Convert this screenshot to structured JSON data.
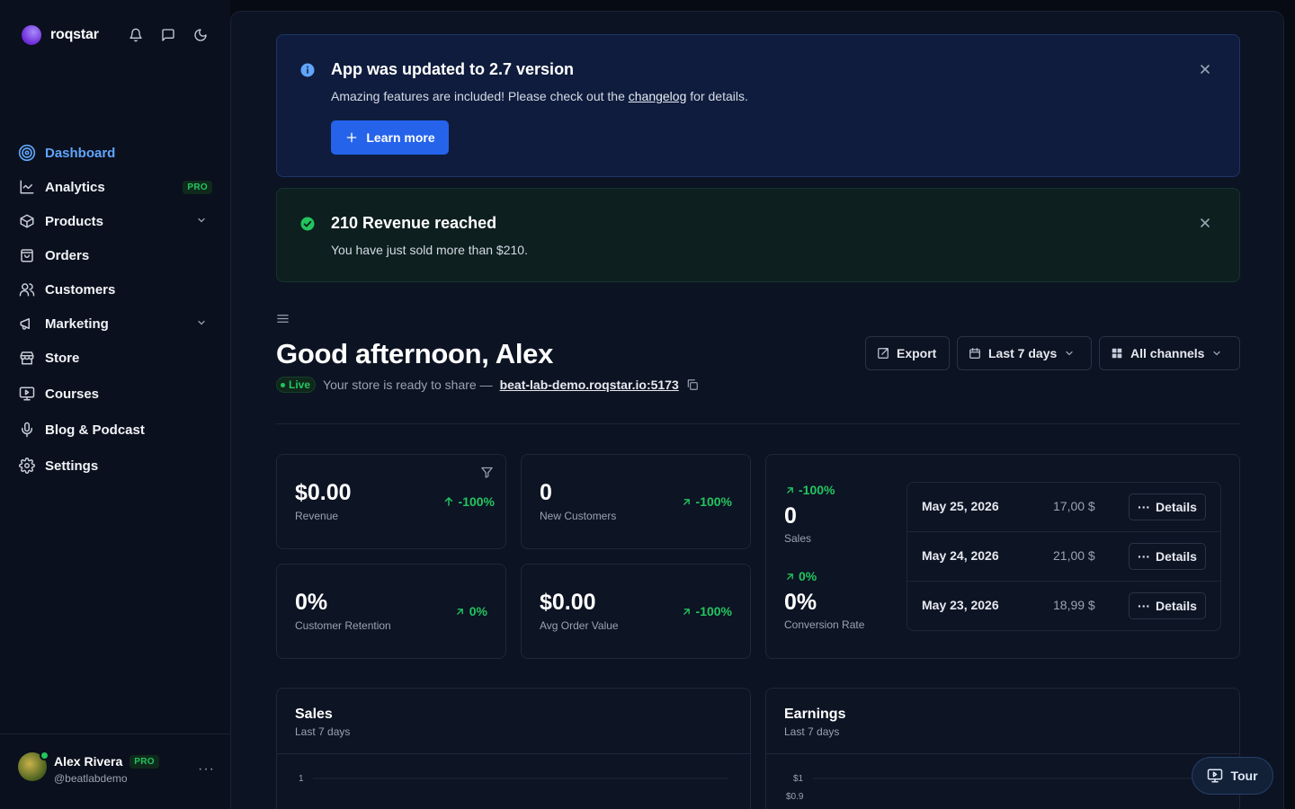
{
  "brand": {
    "name": "roqstar"
  },
  "sidebar": {
    "items": [
      {
        "label": "Dashboard",
        "icon": "target-icon",
        "active": true
      },
      {
        "label": "Analytics",
        "icon": "chart-line-icon",
        "badge": "PRO"
      },
      {
        "label": "Products",
        "icon": "box-icon",
        "expandable": true
      },
      {
        "label": "Orders",
        "icon": "shopping-bag-icon"
      },
      {
        "label": "Customers",
        "icon": "users-icon"
      },
      {
        "label": "Marketing",
        "icon": "megaphone-icon",
        "expandable": true
      },
      {
        "label": "Store",
        "icon": "store-icon"
      },
      {
        "label": "Courses",
        "icon": "presentation-icon"
      },
      {
        "label": "Blog & Podcast",
        "icon": "microphone-icon"
      },
      {
        "label": "Settings",
        "icon": "gear-icon"
      }
    ]
  },
  "user": {
    "name": "Alex Rivera",
    "badge": "PRO",
    "handle": "@beatlabdemo"
  },
  "alerts": {
    "info": {
      "title": "App was updated to 2.7 version",
      "text_before": "Amazing features are included! Please check out the ",
      "link": "changelog",
      "text_after": " for details.",
      "button": "Learn more"
    },
    "success": {
      "title": "210 Revenue reached",
      "text": "You have just sold more than $210."
    }
  },
  "header": {
    "greeting": "Good afternoon, Alex",
    "live_badge": "Live",
    "share_text": "Your store is ready to share —",
    "store_url": "beat-lab-demo.roqstar.io:5173",
    "export_label": "Export",
    "range_label": "Last 7 days",
    "channels_label": "All channels"
  },
  "kpis": {
    "revenue": {
      "value": "$0.00",
      "label": "Revenue",
      "change": "-100%"
    },
    "new_customers": {
      "value": "0",
      "label": "New Customers",
      "change": "-100%"
    },
    "retention": {
      "value": "0%",
      "label": "Customer Retention",
      "change": "0%"
    },
    "avg_order": {
      "value": "$0.00",
      "label": "Avg Order Value",
      "change": "-100%"
    }
  },
  "sales_summary": {
    "sales": {
      "change": "-100%",
      "value": "0",
      "label": "Sales"
    },
    "conversion": {
      "change": "0%",
      "value": "0%",
      "label": "Conversion Rate"
    }
  },
  "orders": [
    {
      "date": "May 25, 2026",
      "amount": "17,00 $",
      "action": "Details"
    },
    {
      "date": "May 24, 2026",
      "amount": "21,00 $",
      "action": "Details"
    },
    {
      "date": "May 23, 2026",
      "amount": "18,99 $",
      "action": "Details"
    }
  ],
  "charts": {
    "sales": {
      "title": "Sales",
      "subtitle": "Last 7 days",
      "ticks": [
        "1"
      ]
    },
    "earnings": {
      "title": "Earnings",
      "subtitle": "Last 7 days",
      "ticks": [
        "$1",
        "$0.9"
      ]
    }
  },
  "tour": {
    "label": "Tour"
  },
  "colors": {
    "accent": "#2563eb",
    "positive": "#22c55e",
    "active_nav": "#60a5fa"
  }
}
